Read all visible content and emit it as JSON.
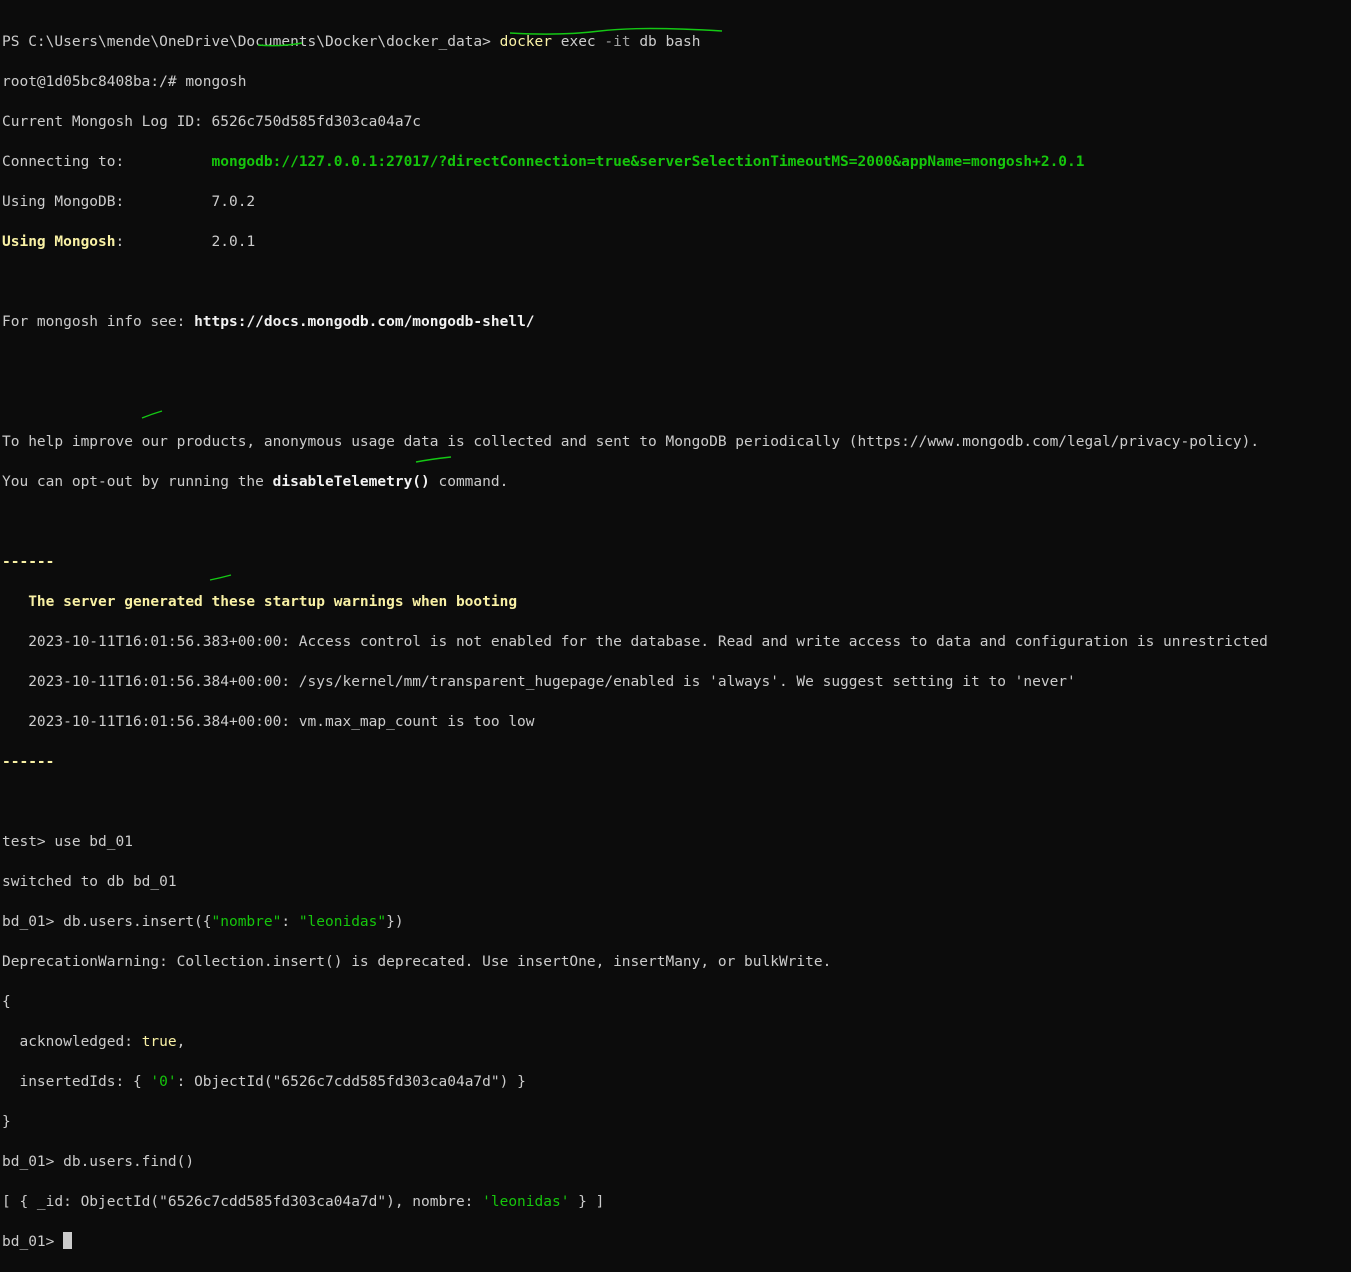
{
  "lines": {
    "l1_prompt": "PS C:\\Users\\mende\\OneDrive\\Documents\\Docker\\docker_data> ",
    "l1_cmd": "docker",
    "l1_exec": " exec ",
    "l1_flag": "-it",
    "l1_rest": " db bash",
    "l2": "root@1d05bc8408ba:/# mongosh",
    "l3": "Current Mongosh Log ID: 6526c750d585fd303ca04a7c",
    "l4_label": "Connecting to:          ",
    "l4_uri": "mongodb://127.0.0.1:27017/?directConnection=true&serverSelectionTimeoutMS=2000&appName=mongosh+2.0.1",
    "l5": "Using MongoDB:          7.0.2",
    "l6_label": "Using Mongosh",
    "l6_rest": ":          2.0.1",
    "l8_text": "For mongosh info see: ",
    "l8_link": "https://docs.mongodb.com/mongodb-shell/",
    "l11": "To help improve our products, anonymous usage data is collected and sent to MongoDB periodically (https://www.mongodb.com/legal/privacy-policy).",
    "l12_a": "You can opt-out by running the ",
    "l12_b": "disableTelemetry()",
    "l12_c": " command.",
    "sep": "------",
    "warn_title": "   The server generated these startup warnings when booting",
    "warn1": "   2023-10-11T16:01:56.383+00:00: Access control is not enabled for the database. Read and write access to data and configuration is unrestricted",
    "warn2": "   2023-10-11T16:01:56.384+00:00: /sys/kernel/mm/transparent_hugepage/enabled is 'always'. We suggest setting it to 'never'",
    "warn3": "   2023-10-11T16:01:56.384+00:00: vm.max_map_count is too low",
    "use_cmd": "test> use bd_01",
    "switched": "switched to db bd_01",
    "insert_a": "bd_01> db.users.insert({",
    "insert_key": "\"nombre\"",
    "insert_colon": ": ",
    "insert_val": "\"leonidas\"",
    "insert_end": "})",
    "deprecation": "DeprecationWarning: Collection.insert() is deprecated. Use insertOne, insertMany, or bulkWrite.",
    "brace_open": "{",
    "ack_key": "  acknowledged: ",
    "ack_val": "true",
    "ack_comma": ",",
    "ids_a": "  insertedIds: { ",
    "ids_key": "'0'",
    "ids_b": ": ObjectId(\"6526c7cdd585fd303ca04a7d\") }",
    "brace_close": "}",
    "find_cmd": "bd_01> db.users.find() ",
    "result_a": "[ { _id: ObjectId(\"6526c7cdd585fd303ca04a7d\"), nombre: ",
    "result_val": "'leonidas'",
    "result_b": " } ]",
    "final_prompt": "bd_01> "
  },
  "colors": {
    "background": "#0c0c0c",
    "text": "#cccccc",
    "yellow": "#f9f1a5",
    "green": "#16c60c",
    "annotation": "#14c814"
  }
}
